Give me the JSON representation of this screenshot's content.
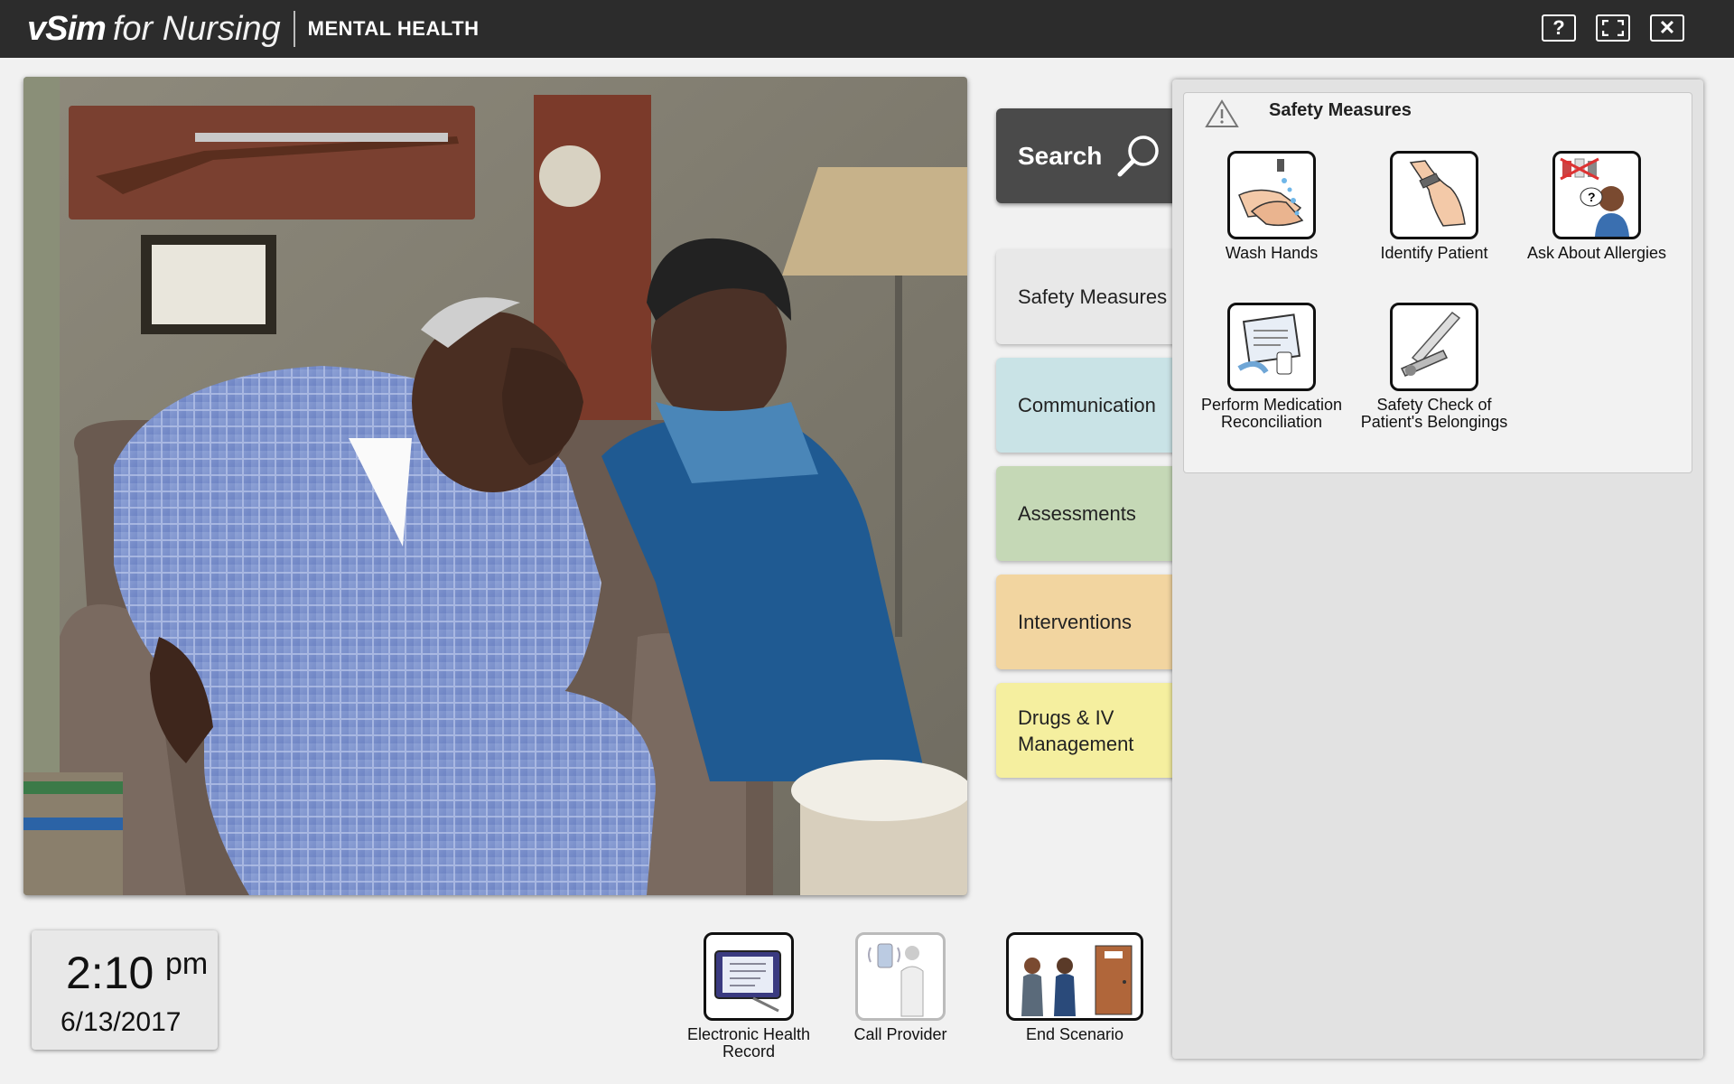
{
  "app": {
    "brand_name": "vSim",
    "brand_suffix": "for Nursing",
    "module": "MENTAL HEALTH",
    "help_label": "?",
    "close_label": "✕"
  },
  "search": {
    "label": "Search"
  },
  "categories": [
    {
      "label": "Safety Measures",
      "color": "#e8e8e8"
    },
    {
      "label": "Communication",
      "color": "#c9e3e6"
    },
    {
      "label": "Assessments",
      "color": "#c5d8b6"
    },
    {
      "label": "Interventions",
      "color": "#f2d5a0"
    },
    {
      "label": "Drugs & IV Management",
      "color": "#f5ef9f"
    }
  ],
  "panel": {
    "title": "Safety Measures",
    "actions": [
      {
        "label": "Wash Hands",
        "icon": "wash-hands-icon"
      },
      {
        "label": "Identify Patient",
        "icon": "identify-patient-icon"
      },
      {
        "label": "Ask About Allergies",
        "icon": "allergies-icon"
      },
      {
        "label": "Perform Medication Reconciliation",
        "icon": "medication-reconciliation-icon"
      },
      {
        "label": "Safety Check of Patient's Belongings",
        "icon": "belongings-check-icon"
      }
    ]
  },
  "clock": {
    "time": "2:10",
    "ampm": "pm",
    "date": "6/13/2017"
  },
  "bottom_actions": [
    {
      "label": "Electronic Health Record",
      "icon": "ehr-icon"
    },
    {
      "label": "Call Provider",
      "icon": "call-provider-icon"
    },
    {
      "label": "End Scenario",
      "icon": "end-scenario-icon"
    }
  ]
}
